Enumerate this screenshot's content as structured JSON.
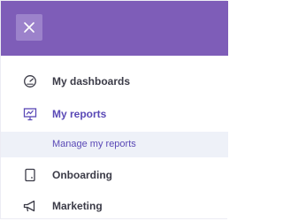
{
  "header": {
    "close_icon": "close-icon"
  },
  "menu": {
    "items": [
      {
        "label": "My dashboards",
        "icon": "speedometer-icon"
      },
      {
        "label": "My reports",
        "icon": "presentation-chart-icon",
        "active": true
      },
      {
        "label": "Onboarding",
        "icon": "device-icon"
      },
      {
        "label": "Marketing",
        "icon": "megaphone-icon"
      }
    ],
    "subitems": [
      {
        "label": "Manage my reports"
      }
    ]
  },
  "colors": {
    "header_bg": "#7e5db8",
    "close_button_bg": "#9c82cb",
    "active_text": "#5a49b6",
    "subitem_bg": "#eef1f8",
    "text": "#3b3b47"
  }
}
